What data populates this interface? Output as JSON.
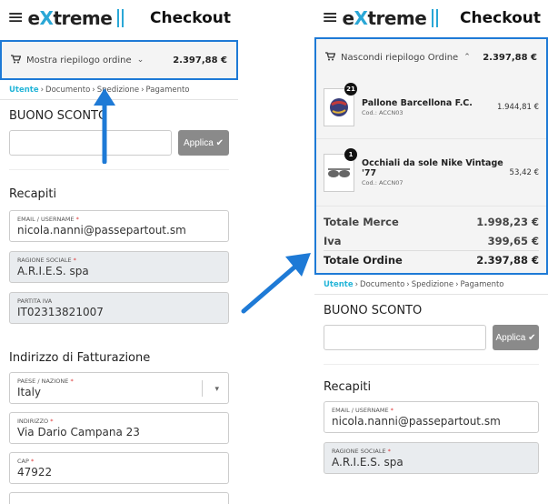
{
  "brand": {
    "logo_e": "e",
    "logo_x": "X",
    "logo_rest": "treme",
    "menu_icon": "hamburger-icon",
    "accent": "#2aa7d6"
  },
  "header": {
    "title": "Checkout"
  },
  "left": {
    "summary_toggle": {
      "label": "Mostra riepilogo ordine",
      "amount": "2.397,88 €",
      "icon": "cart-icon",
      "chevron": "chevron-down-icon"
    },
    "breadcrumbs": [
      "Utente",
      "Documento",
      "Spedizione",
      "Pagamento"
    ],
    "coupon": {
      "title": "BUONO SCONTO",
      "placeholder": "",
      "apply_label": "Applica"
    },
    "contacts": {
      "title": "Recapiti",
      "email_label": "EMAIL / USERNAME",
      "email_value": "nicola.nanni@passepartout.sm",
      "company_label": "RAGIONE SOCIALE",
      "company_value": "A.R.I.E.S. spa",
      "vat_label": "PARTITA IVA",
      "vat_value": "IT02313821007"
    },
    "billing": {
      "title": "Indirizzo di Fatturazione",
      "country_label": "PAESE / NAZIONE",
      "country_value": "Italy",
      "address_label": "INDIRIZZO",
      "address_value": "Via Dario Campana 23",
      "cap_label": "CAP",
      "cap_value": "47922"
    }
  },
  "right": {
    "summary_toggle": {
      "label": "Nascondi riepilogo Ordine",
      "amount": "2.397,88 €",
      "chevron": "chevron-up-icon"
    },
    "products": [
      {
        "qty": "21",
        "name": "Pallone Barcellona F.C.",
        "code": "Cod.: ACCN03",
        "price": "1.944,81 €",
        "thumb": "ball-icon"
      },
      {
        "qty": "1",
        "name": "Occhiali da sole Nike Vintage '77",
        "code": "Cod.: ACCN07",
        "price": "53,42 €",
        "thumb": "sunglasses-icon"
      }
    ],
    "totals": [
      {
        "label": "Totale Merce",
        "value": "1.998,23 €"
      },
      {
        "label": "Iva",
        "value": "399,65 €"
      },
      {
        "label": "Totale Ordine",
        "value": "2.397,88 €"
      }
    ],
    "breadcrumbs": [
      "Utente",
      "Documento",
      "Spedizione",
      "Pagamento"
    ],
    "coupon": {
      "title": "BUONO SCONTO",
      "apply_label": "Applica"
    },
    "contacts": {
      "title": "Recapiti",
      "email_label": "EMAIL / USERNAME",
      "email_value": "nicola.nanni@passepartout.sm",
      "company_label": "RAGIONE SOCIALE",
      "company_value": "A.R.I.E.S. spa"
    }
  },
  "colors": {
    "highlight_border": "#1e7ad6",
    "annotation_arrow": "#1e7ad6",
    "breadcrumb_active": "#24b5d8",
    "button_gray": "#8a8a8a"
  }
}
